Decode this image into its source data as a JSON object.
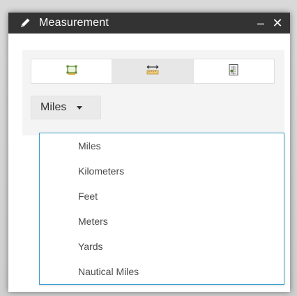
{
  "window": {
    "title": "Measurement",
    "minimize_label": "–",
    "close_label": "✕"
  },
  "tools": [
    {
      "name": "area-tool",
      "icon": "area-measure-icon",
      "active": false
    },
    {
      "name": "distance-tool",
      "icon": "distance-ruler-icon",
      "active": true
    },
    {
      "name": "location-tool",
      "icon": "location-coordinates-icon",
      "active": false
    }
  ],
  "unit_select": {
    "selected": "Miles"
  },
  "dropdown": {
    "options": [
      "Miles",
      "Kilometers",
      "Feet",
      "Meters",
      "Yards",
      "Nautical Miles"
    ]
  },
  "colors": {
    "titlebar": "#333333",
    "dropdown_border": "#3a9fce",
    "icon_green": "#5a8a2e",
    "icon_orange": "#d7a84a"
  }
}
